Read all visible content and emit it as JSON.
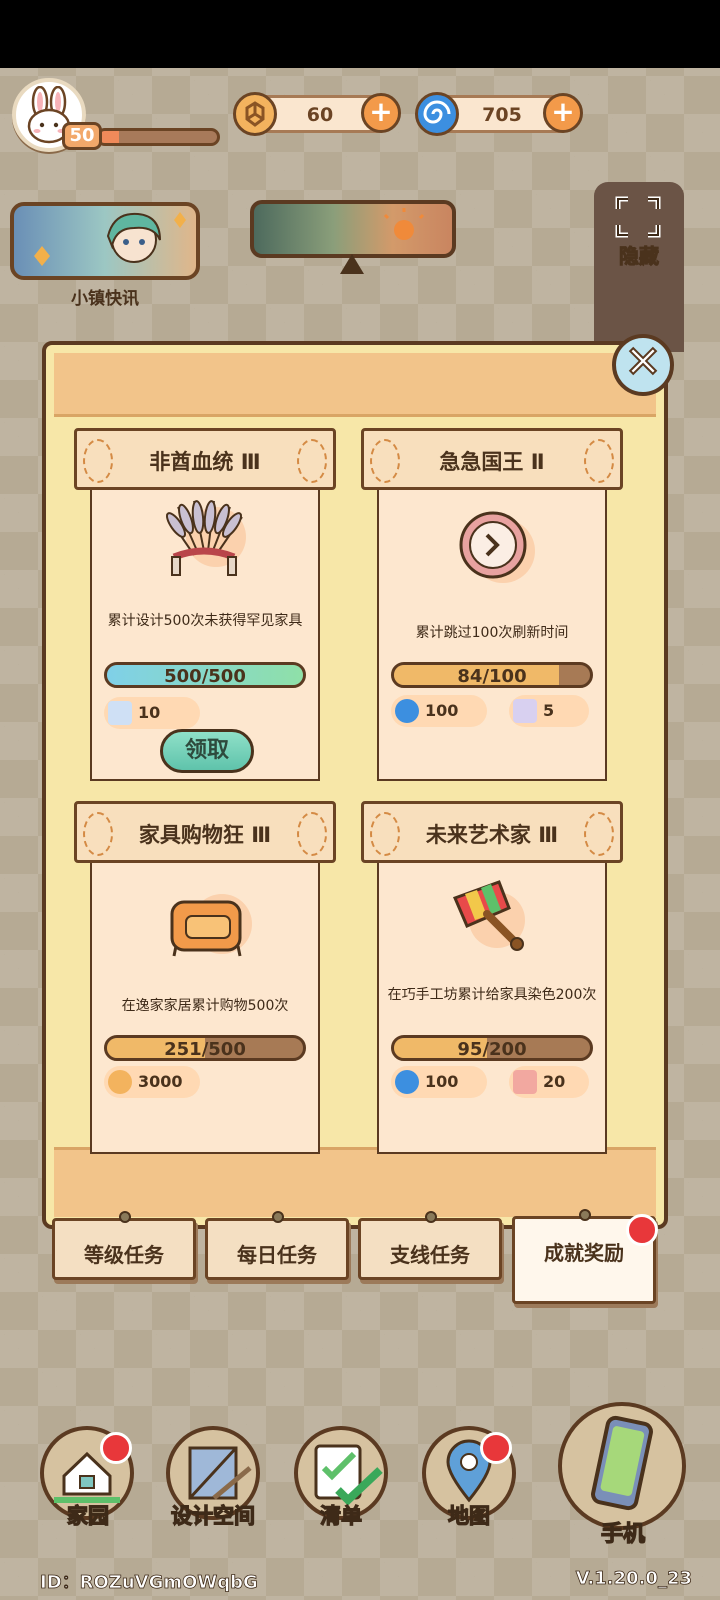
{
  "hud": {
    "level": "50",
    "level_progress": 0.17,
    "currency_gold": "60",
    "currency_swirl": "705",
    "news_label": "小镇快讯",
    "hide_label": "隐藏"
  },
  "achievements": [
    {
      "title": "非酋血统 Ⅲ",
      "icon": "feather-headdress-icon",
      "description": "累计设计500次未获得罕见家具",
      "progress_text": "500/500",
      "progress": 1.0,
      "rewards": [
        {
          "icon": "blueprint-ticket-icon",
          "amount": "10"
        }
      ],
      "claim_label": "领取"
    },
    {
      "title": "急急国王 Ⅱ",
      "icon": "clock-icon",
      "description": "累计跳过100次刷新时间",
      "progress_text": "84/100",
      "progress": 0.84,
      "rewards": [
        {
          "icon": "blue-swirl-icon",
          "amount": "100"
        },
        {
          "icon": "ticket-icon",
          "amount": "5"
        }
      ]
    },
    {
      "title": "家具购物狂 Ⅲ",
      "icon": "armchair-icon",
      "description": "在逸家家居累计购物500次",
      "progress_text": "251/500",
      "progress": 0.502,
      "rewards": [
        {
          "icon": "gold-coin-icon",
          "amount": "3000"
        }
      ]
    },
    {
      "title": "未来艺术家 Ⅲ",
      "icon": "paint-brush-icon",
      "description": "在巧手工坊累计给家具染色200次",
      "progress_text": "95/200",
      "progress": 0.475,
      "rewards": [
        {
          "icon": "blue-swirl-icon",
          "amount": "100"
        },
        {
          "icon": "coupon-icon",
          "amount": "20"
        }
      ]
    }
  ],
  "tabs": [
    "等级任务",
    "每日任务",
    "支线任务",
    "成就奖励"
  ],
  "nav": [
    "家园",
    "设计空间",
    "清单",
    "地图",
    "手机"
  ],
  "footer": {
    "id": "ID：ROZuVGmOWqbG",
    "version": "V.1.20.0_23"
  },
  "colors": {
    "progress_complete": "#7fd8c8",
    "progress_partial": "#f0b968",
    "accent_orange": "#f39a4a"
  }
}
